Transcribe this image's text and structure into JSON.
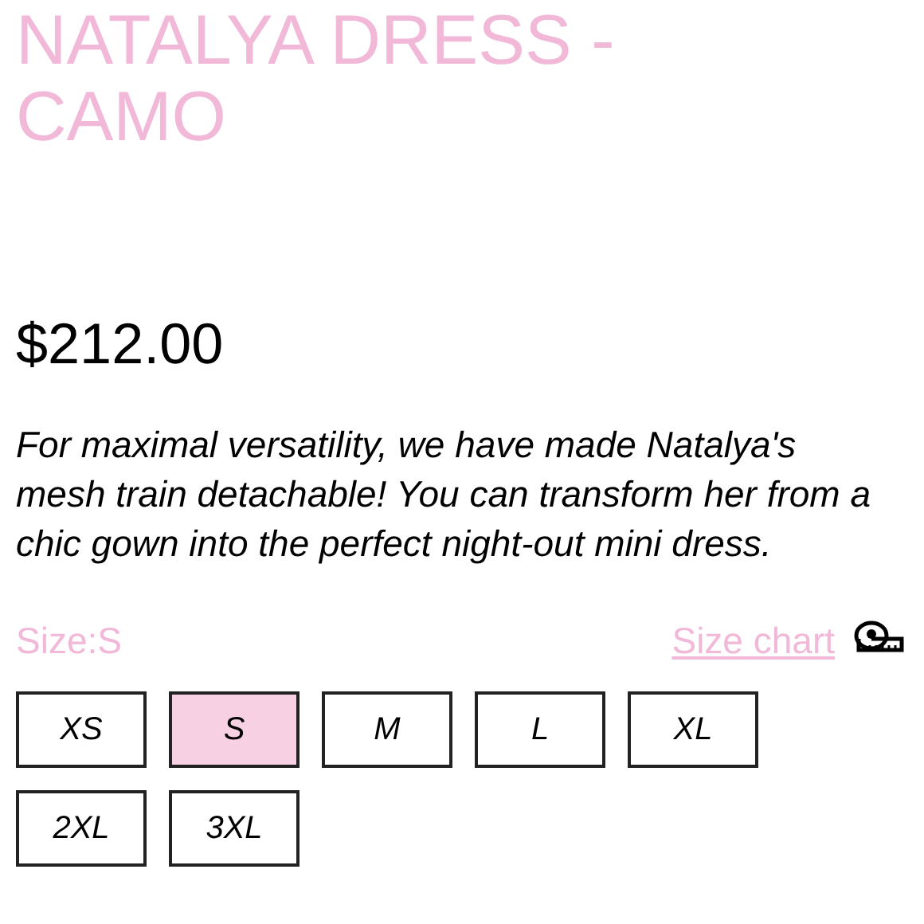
{
  "product": {
    "title": "NATALYA DRESS - CAMO",
    "price": "$212.00",
    "description": "For maximal versatility, we have made Natalya's mesh train detachable! You can transform her from a chic gown into the perfect night-out mini dress."
  },
  "size_label": "Size:S",
  "size_chart_link": "Size chart",
  "sizes": [
    {
      "label": "XS",
      "selected": false
    },
    {
      "label": "S",
      "selected": true
    },
    {
      "label": "M",
      "selected": false
    },
    {
      "label": "L",
      "selected": false
    },
    {
      "label": "XL",
      "selected": false
    },
    {
      "label": "2XL",
      "selected": false
    },
    {
      "label": "3XL",
      "selected": false
    }
  ]
}
